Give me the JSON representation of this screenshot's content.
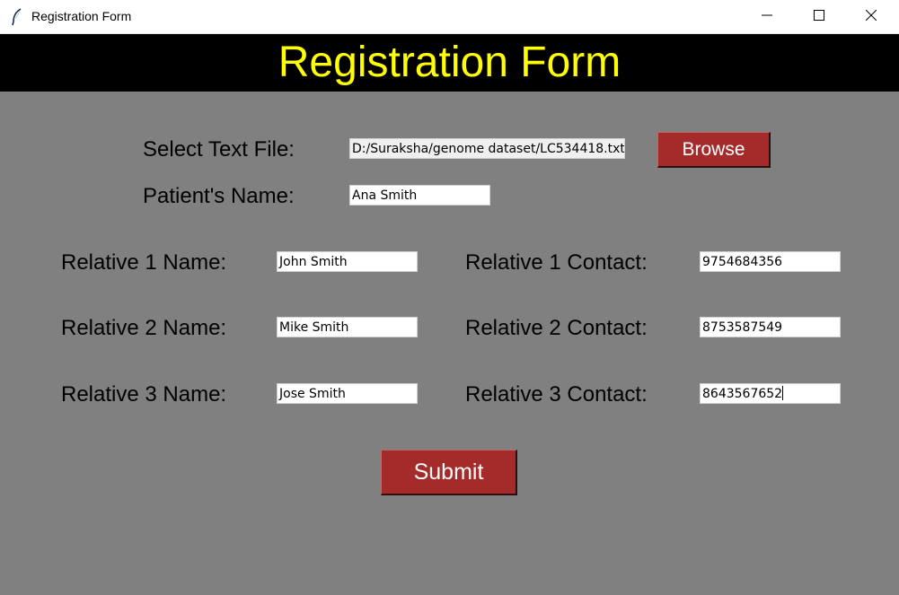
{
  "window": {
    "title": "Registration Form",
    "icon": "feather-icon",
    "controls": [
      "minimize-icon",
      "maximize-icon",
      "close-icon"
    ]
  },
  "banner": {
    "title": "Registration Form",
    "text_color": "#ffff00",
    "background": "#000000"
  },
  "form": {
    "file": {
      "label": "Select Text File:",
      "value": "D:/Suraksha/genome dataset/LC534418.txt"
    },
    "browse_label": "Browse",
    "patient": {
      "label": "Patient's Name:",
      "value": "Ana Smith"
    },
    "relatives": [
      {
        "name_label": "Relative 1 Name:",
        "name_value": "John Smith",
        "contact_label": "Relative 1 Contact:",
        "contact_value": "9754684356"
      },
      {
        "name_label": "Relative 2 Name:",
        "name_value": "Mike Smith",
        "contact_label": "Relative 2 Contact:",
        "contact_value": "8753587549"
      },
      {
        "name_label": "Relative 3 Name:",
        "name_value": "Jose Smith",
        "contact_label": "Relative 3 Contact:",
        "contact_value": "8643567652"
      }
    ],
    "submit_label": "Submit"
  },
  "colors": {
    "form_background": "#808080",
    "button": "#a52a2a",
    "button_text": "#ffffff"
  }
}
